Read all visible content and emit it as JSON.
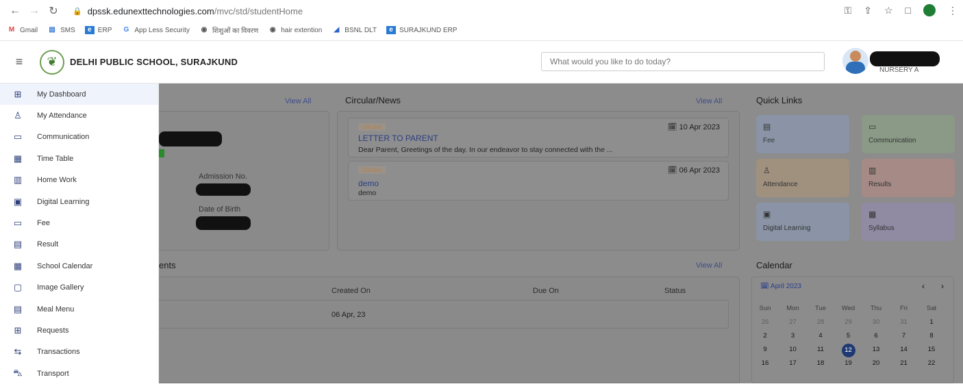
{
  "browser": {
    "url_domain": "dpssk.edunexttechnologies.com",
    "url_path": "/mvc/std/studentHome",
    "bookmarks": [
      "Gmail",
      "SMS",
      "ERP",
      "App Less Security",
      "शिशुओं का विवरण",
      "hair extention",
      "BSNL DLT",
      "SURAJKUND ERP"
    ]
  },
  "header": {
    "school_name": "DELHI PUBLIC SCHOOL, SURAJKUND",
    "search_placeholder": "What would you like to do today?",
    "user_class": "NURSERY A"
  },
  "sidebar": {
    "items": [
      {
        "label": "My Dashboard",
        "icon": "dashboard-icon"
      },
      {
        "label": "My Attendance",
        "icon": "attendance-icon"
      },
      {
        "label": "Communication",
        "icon": "communication-icon"
      },
      {
        "label": "Time Table",
        "icon": "timetable-icon"
      },
      {
        "label": "Home Work",
        "icon": "homework-icon"
      },
      {
        "label": "Digital Learning",
        "icon": "digital-learning-icon"
      },
      {
        "label": "Fee",
        "icon": "fee-icon"
      },
      {
        "label": "Result",
        "icon": "result-icon"
      },
      {
        "label": "School Calendar",
        "icon": "calendar-icon"
      },
      {
        "label": "Image Gallery",
        "icon": "gallery-icon"
      },
      {
        "label": "Meal Menu",
        "icon": "meal-icon"
      },
      {
        "label": "Requests",
        "icon": "requests-icon"
      },
      {
        "label": "Transactions",
        "icon": "transactions-icon"
      },
      {
        "label": "Transport",
        "icon": "transport-icon"
      }
    ]
  },
  "profile_card": {
    "view_all": "View All",
    "admission_label": "Admission No.",
    "dob_label": "Date of Birth"
  },
  "circular": {
    "title": "Circular/News",
    "view_all": "View All",
    "items": [
      {
        "tag": "Circular",
        "date": "10 Apr 2023",
        "title": "LETTER TO PARENT",
        "desc": "Dear Parent, Greetings of the day. In our endeavor to stay connected with the ..."
      },
      {
        "tag": "Circular",
        "date": "06 Apr 2023",
        "title": "demo",
        "desc": "demo"
      }
    ]
  },
  "quick_links": {
    "title": "Quick Links",
    "items": [
      {
        "label": "Fee",
        "color": "#8a94a6"
      },
      {
        "label": "Communication",
        "color": "#8a9a86"
      },
      {
        "label": "Attendance",
        "color": "#a0917f"
      },
      {
        "label": "Results",
        "color": "#a58a86"
      },
      {
        "label": "Digital Learning",
        "color": "#8a94a6"
      },
      {
        "label": "Syllabus",
        "color": "#918aa3"
      }
    ]
  },
  "assignments": {
    "title_fragment": "ents",
    "view_all": "View All",
    "headers": {
      "created": "Created On",
      "due": "Due On",
      "status": "Status"
    },
    "rows": [
      {
        "created": "06 Apr, 23",
        "due": "",
        "status": ""
      }
    ]
  },
  "calendar": {
    "title": "Calendar",
    "month": "April 2023",
    "prev": "‹",
    "next": "›",
    "dow": [
      "Sun",
      "Mon",
      "Tue",
      "Wed",
      "Thu",
      "Fri",
      "Sat"
    ],
    "weeks": [
      [
        "26",
        "27",
        "28",
        "29",
        "30",
        "31",
        "1"
      ],
      [
        "2",
        "3",
        "4",
        "5",
        "6",
        "7",
        "8"
      ],
      [
        "9",
        "10",
        "11",
        "12",
        "13",
        "14",
        "15"
      ],
      [
        "16",
        "17",
        "18",
        "19",
        "20",
        "21",
        "22"
      ]
    ],
    "today": "12"
  }
}
